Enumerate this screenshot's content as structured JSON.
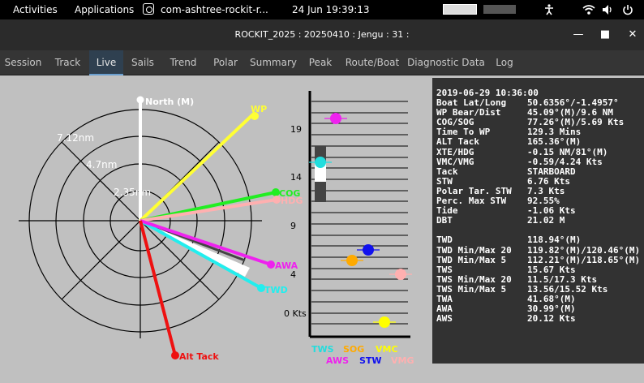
{
  "topbar": {
    "activities": "Activities",
    "applications": "Applications",
    "app_title": "com-ashtree-rockit-r...",
    "clock": "24 Jun  19:39:13"
  },
  "window": {
    "title": "ROCKIT_2025 : 20250410 : Jengu : 31 :"
  },
  "tabs": [
    "Session",
    "Track",
    "Live",
    "Sails",
    "Trend",
    "Polar",
    "Summary",
    "Peak",
    "Route/Boat",
    "Diagnostic Data",
    "Log"
  ],
  "active_tab": "Live",
  "compass": {
    "ring_labels": [
      "7.12nm",
      "4.7nm",
      "2.35nm"
    ],
    "vectors": [
      {
        "label": "North (M)",
        "color": "#ffffff"
      },
      {
        "label": "WP",
        "color": "#ffff33"
      },
      {
        "label": "COG",
        "color": "#22ee22"
      },
      {
        "label": "HDG",
        "color": "#ffb0b0"
      },
      {
        "label": "AWA",
        "color": "#ee22ee"
      },
      {
        "label": "TWD",
        "color": "#22eeee"
      },
      {
        "label": "Alt Tack",
        "color": "#ee1111"
      }
    ]
  },
  "speed_scale": {
    "ticks": [
      "19",
      "14",
      "9",
      "4",
      "0 Kts"
    ],
    "legend_row1": [
      {
        "label": "TWS",
        "color": "#22dddd"
      },
      {
        "label": "SOG",
        "color": "#ffaa00"
      },
      {
        "label": "VMC",
        "color": "#ffff00"
      }
    ],
    "legend_row2": [
      {
        "label": "AWS",
        "color": "#ee22ee"
      },
      {
        "label": "STW",
        "color": "#1111ee"
      },
      {
        "label": "VMG",
        "color": "#ffb0b0"
      }
    ],
    "markers_kts": {
      "AWS": 20.12,
      "TWS": 15.67,
      "STW": 6.76,
      "SOG": 5.69,
      "VMG": 4.24,
      "VMC": -1.3
    }
  },
  "info": {
    "timestamp": "2019-06-29 10:36:00",
    "rows": [
      {
        "label": "Boat Lat/Long",
        "value": "50.6356°/-1.4957°"
      },
      {
        "label": "WP Bear/Dist",
        "value": "45.09°(M)/9.6 NM"
      },
      {
        "label": "COG/SOG",
        "value": "77.26°(M)/5.69 Kts"
      },
      {
        "label": "Time To WP",
        "value": "129.3 Mins"
      },
      {
        "label": "ALT Tack",
        "value": "165.36°(M)"
      },
      {
        "label": "XTE/HDG",
        "value": "-0.15 NM/81°(M)"
      },
      {
        "label": "VMC/VMG",
        "value": "-0.59/4.24 Kts"
      },
      {
        "label": "Tack",
        "value": "STARBOARD"
      },
      {
        "label": "STW",
        "value": "6.76 Kts"
      },
      {
        "label": "Polar Tar. STW",
        "value": "7.3 Kts"
      },
      {
        "label": "Perc. Max STW",
        "value": "92.55%"
      },
      {
        "label": "Tide",
        "value": "-1.06 Kts"
      },
      {
        "label": "DBT",
        "value": "21.02 M"
      },
      {
        "label": "",
        "value": ""
      },
      {
        "label": "TWD",
        "value": "118.94°(M)"
      },
      {
        "label": "TWD Min/Max 20",
        "value": "119.82°(M)/120.46°(M)"
      },
      {
        "label": "TWD Min/Max 5",
        "value": "112.21°(M)/118.65°(M)"
      },
      {
        "label": "TWS",
        "value": "15.67 Kts"
      },
      {
        "label": "TWS Min/Max 20",
        "value": "11.5/17.3 Kts"
      },
      {
        "label": "TWS Min/Max 5",
        "value": "13.56/15.52 Kts"
      },
      {
        "label": "TWA",
        "value": "41.68°(M)"
      },
      {
        "label": "AWA",
        "value": "30.99°(M)"
      },
      {
        "label": "AWS",
        "value": "20.12 Kts"
      }
    ]
  }
}
